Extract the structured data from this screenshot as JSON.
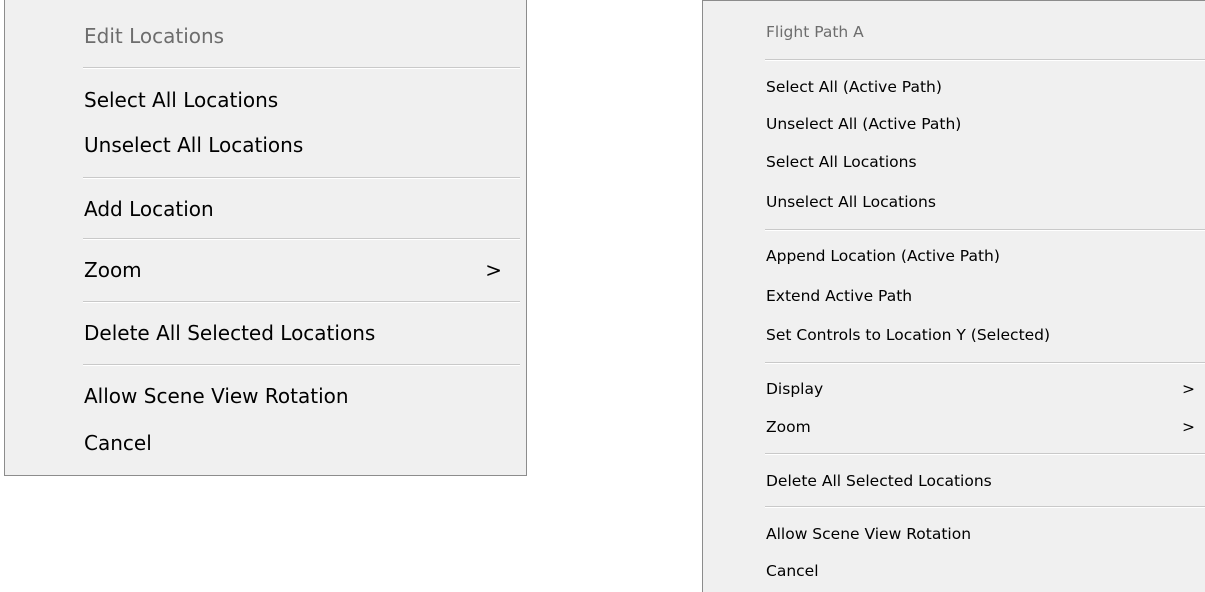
{
  "left_menu": {
    "header": "Edit Locations",
    "select_all_locations": "Select All Locations",
    "unselect_all_locations": "Unselect All Locations",
    "add_location": "Add Location",
    "zoom": "Zoom",
    "delete_all_selected": "Delete All Selected Locations",
    "allow_scene_view_rotation": "Allow Scene View Rotation",
    "cancel": "Cancel",
    "submenu_arrow": ">"
  },
  "right_menu": {
    "header": "Flight Path A",
    "select_all_active_path": "Select All (Active Path)",
    "unselect_all_active_path": "Unselect All (Active Path)",
    "select_all_locations": "Select All Locations",
    "unselect_all_locations": "Unselect All Locations",
    "append_location_active_path": "Append Location (Active Path)",
    "extend_active_path": "Extend Active Path",
    "set_controls_to_location": "Set Controls to Location Y (Selected)",
    "display": "Display",
    "zoom": "Zoom",
    "delete_all_selected": "Delete All Selected Locations",
    "allow_scene_view_rotation": "Allow Scene View Rotation",
    "cancel": "Cancel",
    "submenu_arrow": ">"
  }
}
